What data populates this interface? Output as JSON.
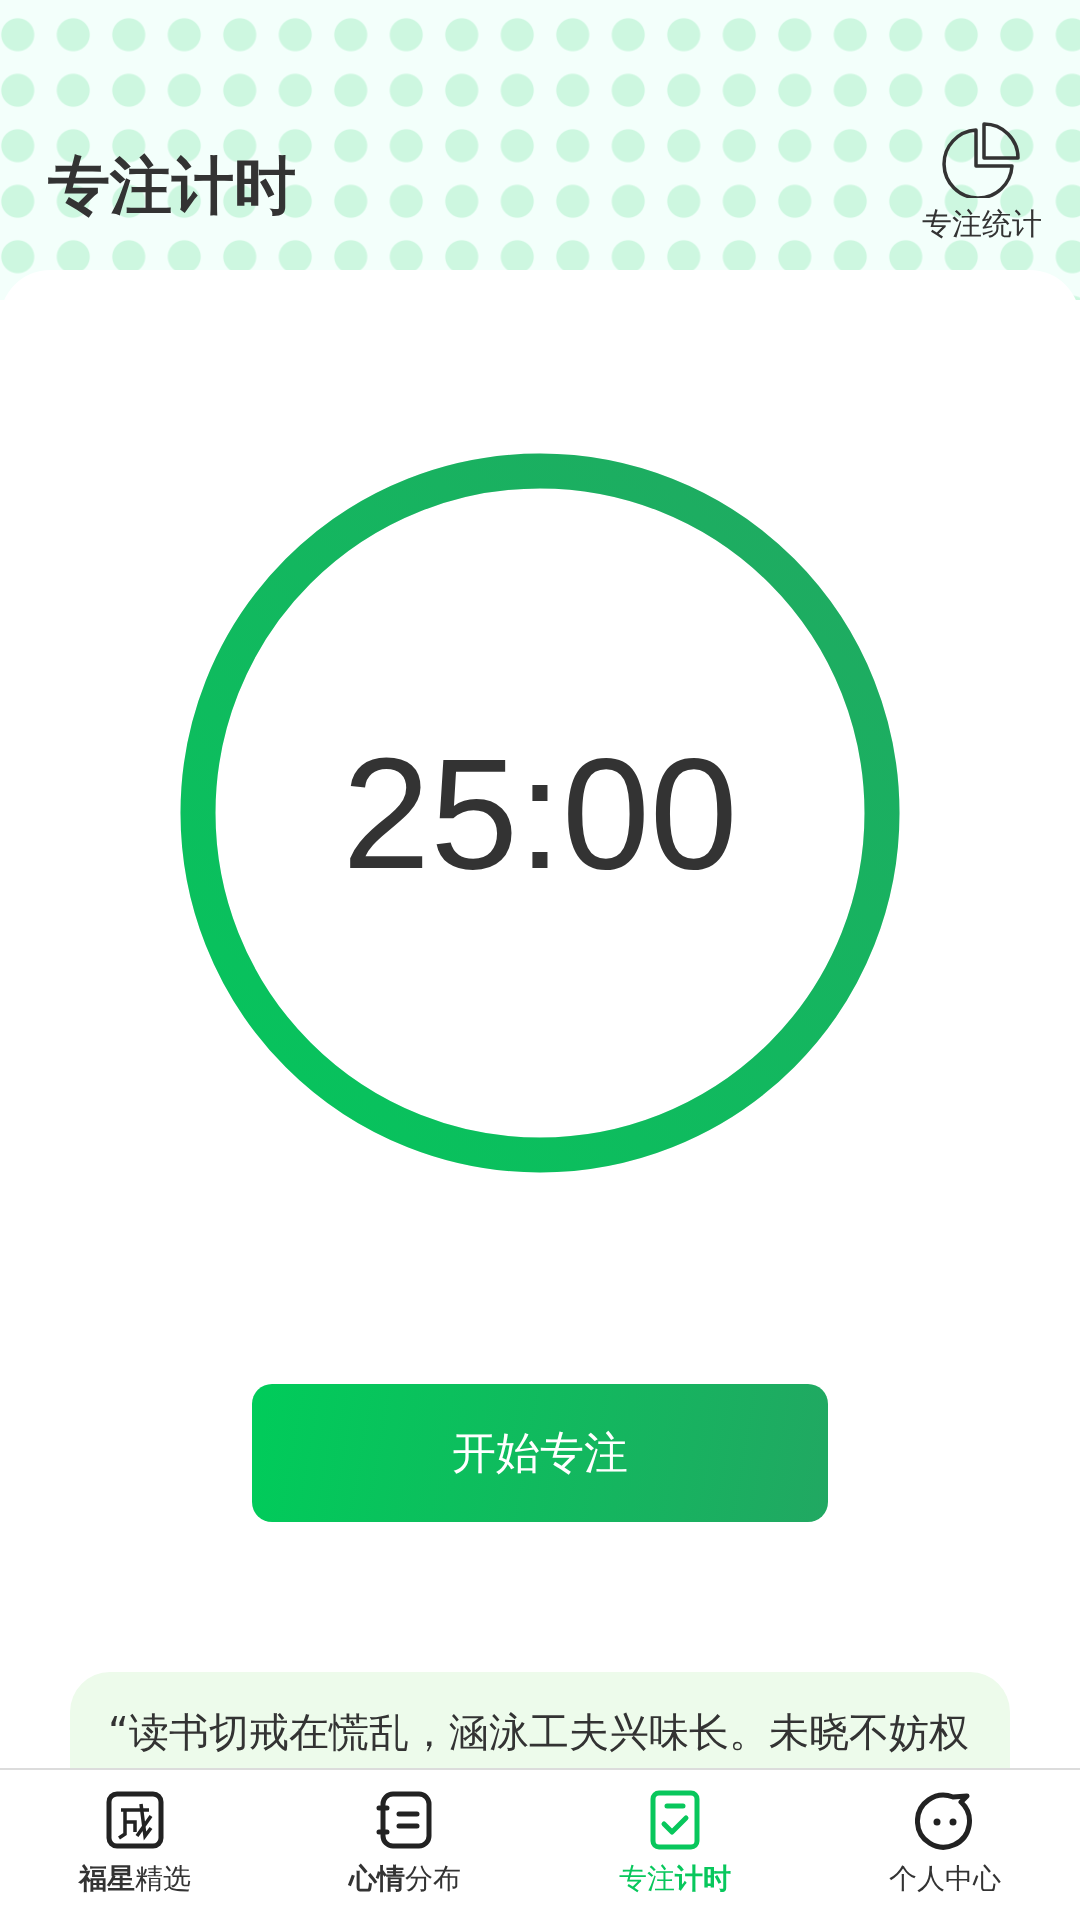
{
  "header": {
    "title": "专注计时",
    "stats_button": {
      "label": "专注统计"
    }
  },
  "timer": {
    "time": "25:00",
    "level": 1
  },
  "start_button": {
    "label": "开始专注"
  },
  "quote": {
    "text": "“读书切戒在慌乱，涵泳工夫兴味长。未晓不妨权"
  },
  "tabs": [
    {
      "label": "**福星**精选",
      "kind": "idiom",
      "selected": false
    },
    {
      "label": "**心情**分布",
      "kind": "notebook",
      "selected": false
    },
    {
      "label": "专注**计时**",
      "kind": "checklist",
      "selected": true
    },
    {
      "label": "个人中心",
      "kind": "face",
      "selected": false
    }
  ]
}
